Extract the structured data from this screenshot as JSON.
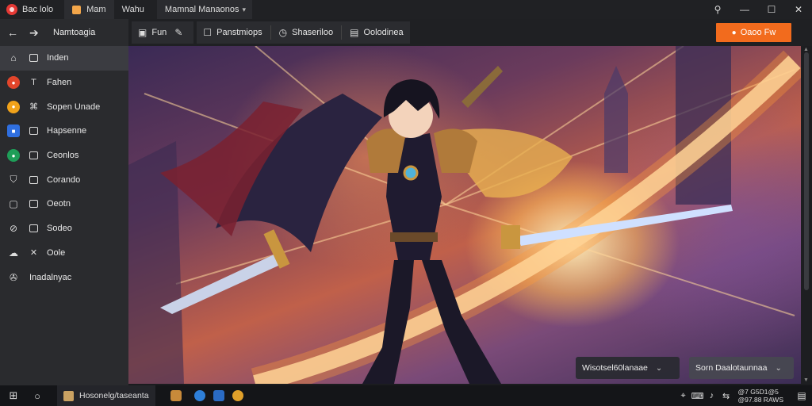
{
  "titlebar": {
    "app_title": "Bac lolo",
    "tabs": [
      {
        "label": "Mam",
        "active": true
      },
      {
        "label": "Wahu",
        "active": false
      }
    ],
    "menu_label": "Mamnal Manaonos",
    "controls": {
      "pin": "⚲",
      "minimize": "—",
      "maximize": "☐",
      "close": "✕"
    }
  },
  "sidebar": {
    "back_icon": "arrow-left-icon",
    "header_label": "Namtoagia",
    "items": [
      {
        "label": "Inden",
        "icon": "home-icon",
        "active": true
      },
      {
        "label": "Fahen",
        "icon": "orange-red-circle-icon",
        "color": "#e2452b"
      },
      {
        "label": "Sopen Unade",
        "icon": "yellow-circle-icon",
        "color": "#f0a21a"
      },
      {
        "label": "Hapsenne",
        "icon": "blue-square-icon",
        "color": "#2f6fe0"
      },
      {
        "label": "Ceonlos",
        "icon": "green-circle-icon",
        "color": "#1e9e58"
      },
      {
        "label": "Corando",
        "icon": "shield-icon"
      },
      {
        "label": "Oeotn",
        "icon": "tag-icon"
      },
      {
        "label": "Sodeo",
        "icon": "compass-icon"
      },
      {
        "label": "Oole",
        "icon": "cloud-icon"
      },
      {
        "label": "Inadalnyac",
        "icon": "settings-icon"
      }
    ]
  },
  "toolbar": {
    "group1": [
      {
        "label": "Fun",
        "icon": "image-icon"
      },
      {
        "label": "",
        "icon": "pencil-icon"
      }
    ],
    "group2": {
      "label": "Panstmiops",
      "icon": "square-icon"
    },
    "group3": {
      "label": "Shaseriloo",
      "icon": "clock-icon"
    },
    "group4": {
      "label": "Oolodinea",
      "icon": "doc-icon"
    },
    "primary_label": "Oaoo Fw",
    "primary_icon": "user-icon",
    "accent": "#f26b1d"
  },
  "canvas": {
    "selector_left": "Wisotsel60lanaae",
    "selector_right": "Sorn Daalotaunnaa"
  },
  "taskbar": {
    "start_icon": "windows-icon",
    "search_icon": "circle-icon",
    "active_app_label": "Hosonelg/taseanta",
    "pinned": [
      {
        "icon": "paint-icon",
        "color": "#c88a3a"
      },
      {
        "icon": "edge-icon",
        "color": "#2e7fd8"
      },
      {
        "icon": "store-icon",
        "color": "#2a6bc4"
      },
      {
        "icon": "chrome-icon",
        "color": "#e0a02a"
      }
    ],
    "tray_icons": [
      "location-icon",
      "keyboard-icon",
      "speaker-icon",
      "network-icon"
    ],
    "clock_line1": "@7  G5D1@5",
    "clock_line2": "@97.88  RAWS",
    "notification_icon": "notification-icon"
  }
}
